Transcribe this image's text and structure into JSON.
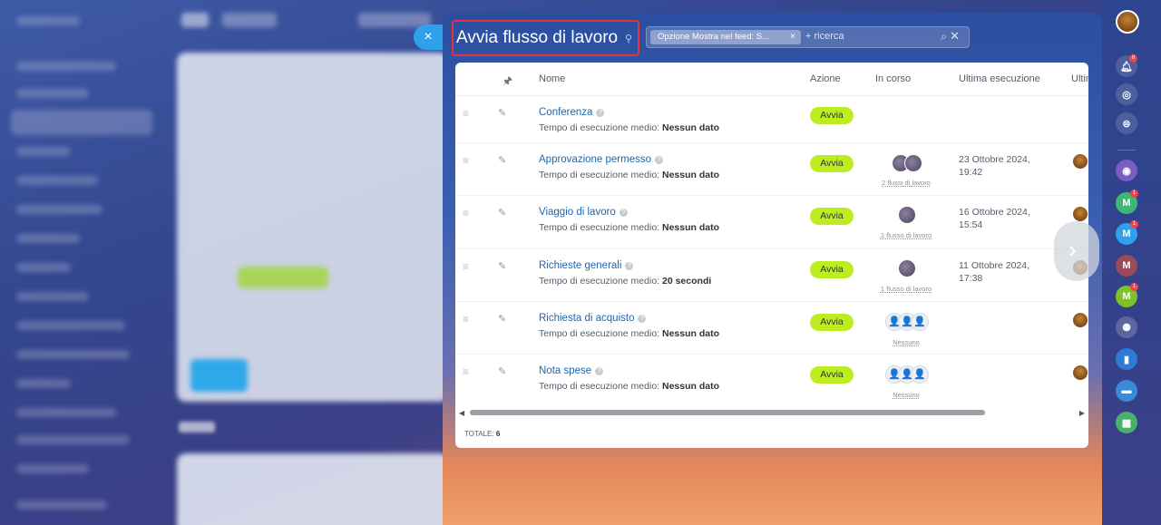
{
  "panel": {
    "title": "Avvia flusso di lavoro",
    "close_label": "×",
    "filter_chip": "Opzione Mostra nel feed: S...",
    "filter_chip_close": "×",
    "search_placeholder": "+ ricerca"
  },
  "table": {
    "columns": [
      "Nome",
      "Azione",
      "In corso",
      "Ultima esecuzione",
      "Ultim"
    ],
    "duration_prefix": "Tempo di esecuzione medio:",
    "rows": [
      {
        "name": "Conferenza",
        "duration": "Nessun dato",
        "action": "Avvia",
        "running": "",
        "last_run": ""
      },
      {
        "name": "Approvazione permesso",
        "duration": "Nessun dato",
        "action": "Avvia",
        "running": "2 flussi di lavoro",
        "last_run": "23 Ottobre 2024, 19:42"
      },
      {
        "name": "Viaggio di lavoro",
        "duration": "Nessun dato",
        "action": "Avvia",
        "running": "1 flusso di lavoro",
        "last_run": "16 Ottobre 2024, 15:54"
      },
      {
        "name": "Richieste generali",
        "duration": "20 secondi",
        "action": "Avvia",
        "running": "1 flusso di lavoro",
        "last_run": "11 Ottobre 2024, 17:38"
      },
      {
        "name": "Richiesta di acquisto",
        "duration": "Nessun dato",
        "action": "Avvia",
        "running": "Nessuno",
        "last_run": ""
      },
      {
        "name": "Nota spese",
        "duration": "Nessun dato",
        "action": "Avvia",
        "running": "Nessuno",
        "last_run": ""
      }
    ],
    "total_label": "TOTALE:",
    "total_value": "6"
  },
  "rightbar": {
    "notifications_badge": "8",
    "m_letter": "M",
    "m_badge": "1"
  },
  "colors": {
    "accent": "#2fa0ea",
    "action_green": "#bbed21",
    "highlight_red": "#e5333c",
    "link_blue": "#2066b0"
  }
}
